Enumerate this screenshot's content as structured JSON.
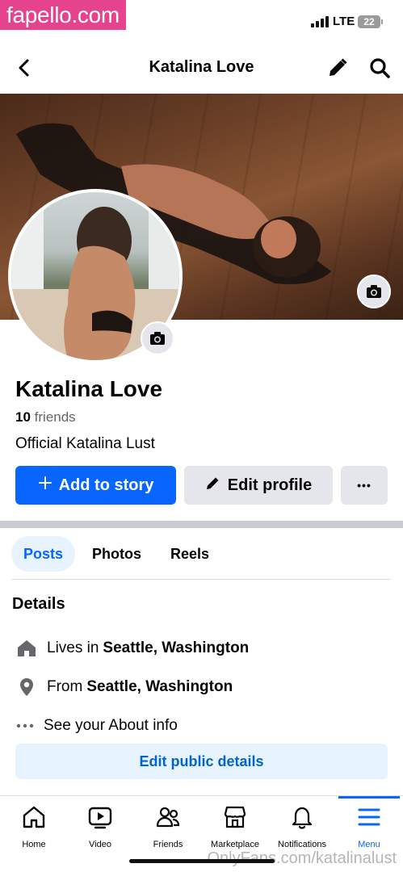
{
  "watermark": {
    "top": "fapello.com",
    "bottom": "OnlyFans.com/katalinalust"
  },
  "status_bar": {
    "network": "LTE",
    "battery": "22"
  },
  "header": {
    "title": "Katalina Love"
  },
  "profile": {
    "name": "Katalina Love",
    "friends_count": "10",
    "friends_label": "friends",
    "bio": "Official Katalina Lust"
  },
  "actions": {
    "add_story": "Add to story",
    "edit_profile": "Edit profile",
    "more": "•••"
  },
  "tabs": [
    {
      "label": "Posts",
      "active": true
    },
    {
      "label": "Photos",
      "active": false
    },
    {
      "label": "Reels",
      "active": false
    }
  ],
  "details": {
    "title": "Details",
    "lives_prefix": "Lives in",
    "lives_value": "Seattle, Washington",
    "from_prefix": "From",
    "from_value": "Seattle, Washington",
    "about": "See your About info",
    "edit_public": "Edit public details"
  },
  "bottom_nav": [
    {
      "label": "Home",
      "icon": "home-icon"
    },
    {
      "label": "Video",
      "icon": "video-icon"
    },
    {
      "label": "Friends",
      "icon": "friends-icon"
    },
    {
      "label": "Marketplace",
      "icon": "marketplace-icon"
    },
    {
      "label": "Notifications",
      "icon": "bell-icon"
    },
    {
      "label": "Menu",
      "icon": "menu-icon",
      "active": true
    }
  ],
  "colors": {
    "accent": "#0866ff",
    "secondary_button": "#e4e6eb",
    "tab_active_bg": "#e7f3ff"
  }
}
